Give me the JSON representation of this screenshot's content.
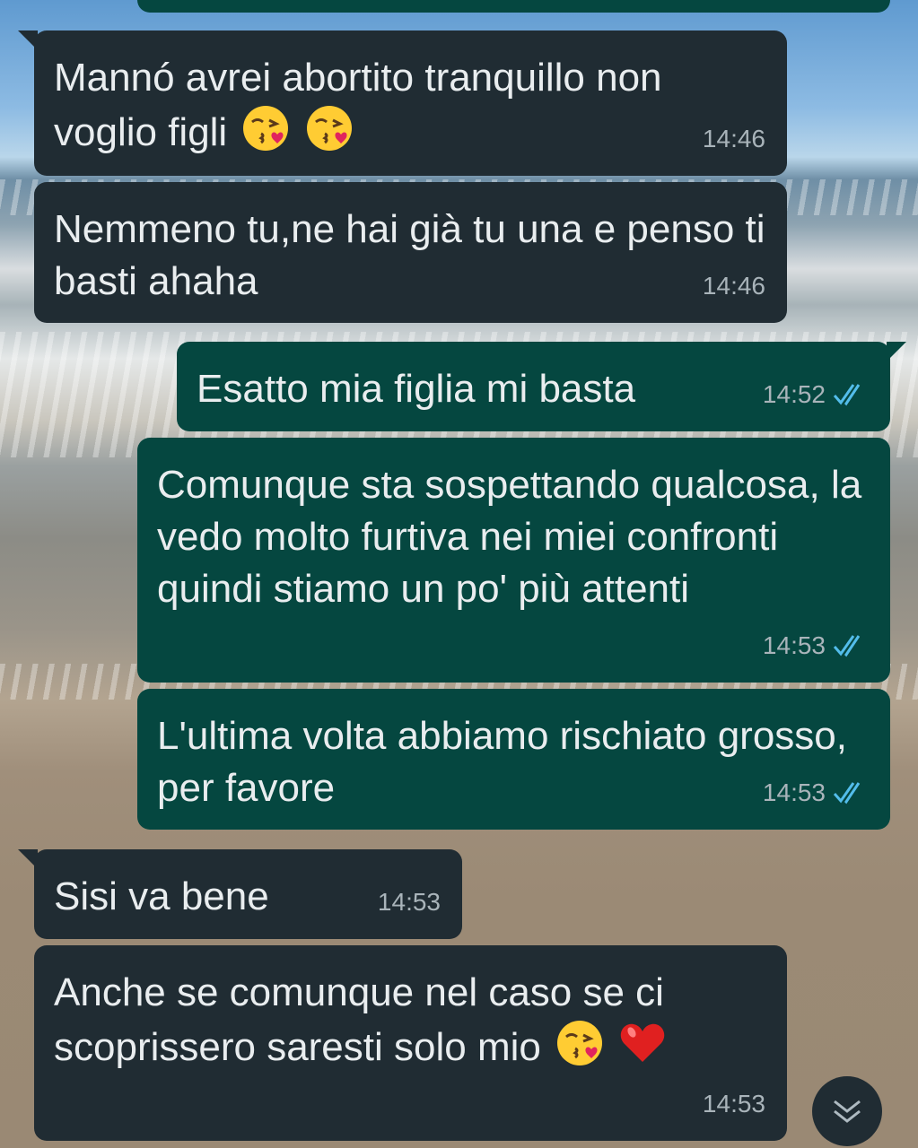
{
  "messages": [
    {
      "direction": "in",
      "text": "Mannó avrei abortito tranquillo non voglio figli",
      "emojis": [
        "kiss-face",
        "kiss-face"
      ],
      "time": "14:46"
    },
    {
      "direction": "in",
      "text": "Nemmeno tu,ne hai già tu una e penso ti basti ahaha",
      "time": "14:46"
    },
    {
      "direction": "out",
      "text": "Esatto mia figlia mi basta",
      "time": "14:52",
      "status": "read"
    },
    {
      "direction": "out",
      "text": "Comunque sta sospettando qualcosa, la vedo molto furtiva nei miei confronti quindi stiamo un po' più attenti",
      "time": "14:53",
      "status": "read"
    },
    {
      "direction": "out",
      "text": "L'ultima volta abbiamo rischiato grosso, per favore",
      "time": "14:53",
      "status": "read"
    },
    {
      "direction": "in",
      "text": "Sisi va bene",
      "time": "14:53"
    },
    {
      "direction": "in",
      "text": "Anche se comunque nel caso se ci scoprissero saresti solo mio",
      "emojis": [
        "kiss-face",
        "red-heart"
      ],
      "time": "14:53"
    }
  ],
  "colors": {
    "incoming_bubble": "#202c33",
    "outgoing_bubble": "#054740",
    "read_ticks": "#53bdeb",
    "timestamp": "#a9b4ba"
  },
  "icons": {
    "scroll_down": "chevron-down-double-icon",
    "read_status": "double-check-icon"
  }
}
